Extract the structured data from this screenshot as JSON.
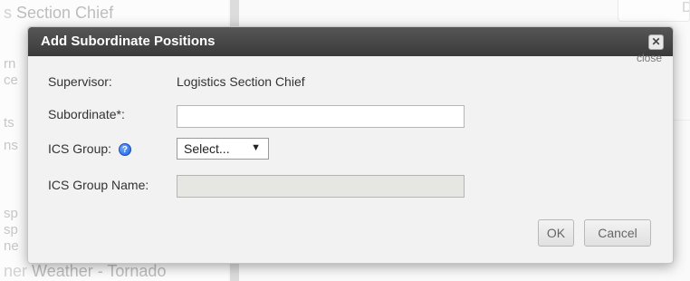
{
  "background": {
    "left_items": [
      "Section Chief",
      "Weather - Tornado"
    ],
    "right_button_partial": "Del"
  },
  "dialog": {
    "title": "Add Subordinate Positions",
    "close_label": "close",
    "supervisor": {
      "label": "Supervisor:",
      "value": "Logistics Section Chief"
    },
    "subordinate": {
      "label": "Subordinate*:",
      "value": ""
    },
    "ics_group": {
      "label": "ICS Group:",
      "help": "?",
      "selected": "Select..."
    },
    "ics_group_name": {
      "label": "ICS Group Name:",
      "value": ""
    },
    "buttons": {
      "ok": "OK",
      "cancel": "Cancel"
    }
  },
  "colors": {
    "titlebar": "#3e3e3e",
    "dialog_bg": "#f2f2f2",
    "help_icon": "#1f5fd6"
  }
}
